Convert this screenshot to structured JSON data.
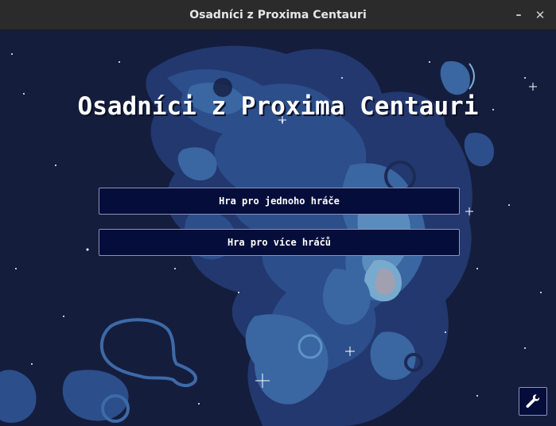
{
  "window": {
    "title": "Osadníci z Proxima Centauri",
    "minimize_glyph": "–",
    "close_glyph": "✕"
  },
  "game": {
    "title": "Osadníci z Proxima Centauri",
    "menu": {
      "single_player_label": "Hra pro jednoho hráče",
      "multiplayer_label": "Hra pro více hráčů"
    },
    "settings_icon": "wrench-icon"
  },
  "colors": {
    "space": "#151d3d",
    "nebula_dark": "#233a72",
    "nebula_mid": "#3d6aa8",
    "nebula_light": "#7eb2d6",
    "button_bg": "#050d3a",
    "button_border": "#8a94b8"
  }
}
